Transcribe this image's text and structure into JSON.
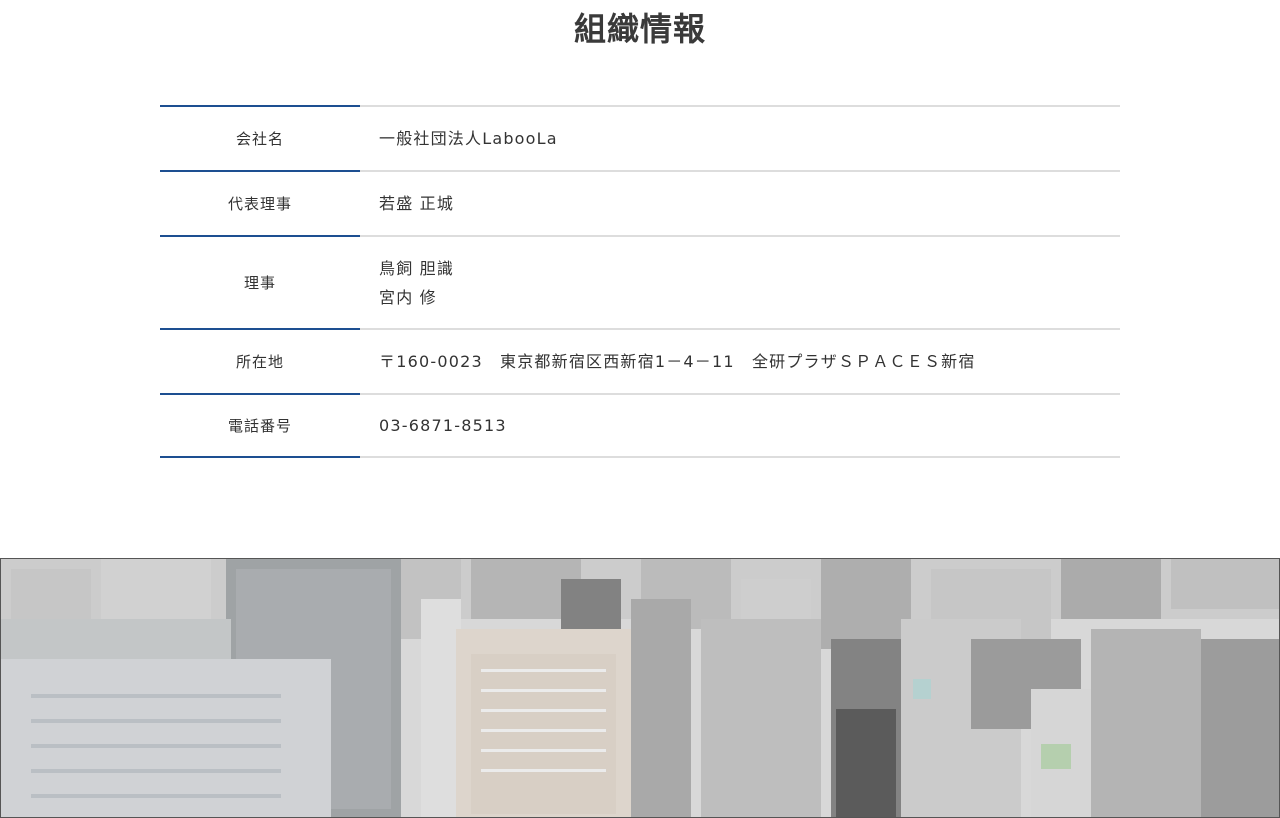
{
  "page": {
    "title": "組織情報"
  },
  "rows": [
    {
      "label": "会社名",
      "values": [
        "一般社団法人LabooLa"
      ]
    },
    {
      "label": "代表理事",
      "values": [
        "若盛 正城"
      ]
    },
    {
      "label": "理事",
      "values": [
        "鳥飼 胆識",
        "宮内 修"
      ]
    },
    {
      "label": "所在地",
      "values": [
        "〒160-0023　東京都新宿区西新宿1－4－11　全研プラザＳＰＡＣＥＳ新宿"
      ]
    },
    {
      "label": "電話番号",
      "values": [
        "03-6871-8513"
      ]
    }
  ],
  "colors": {
    "label_border": "#1d4f91",
    "value_border": "#dddddd",
    "text": "#333333"
  },
  "banner": {
    "image": "city-skyline-photo"
  }
}
